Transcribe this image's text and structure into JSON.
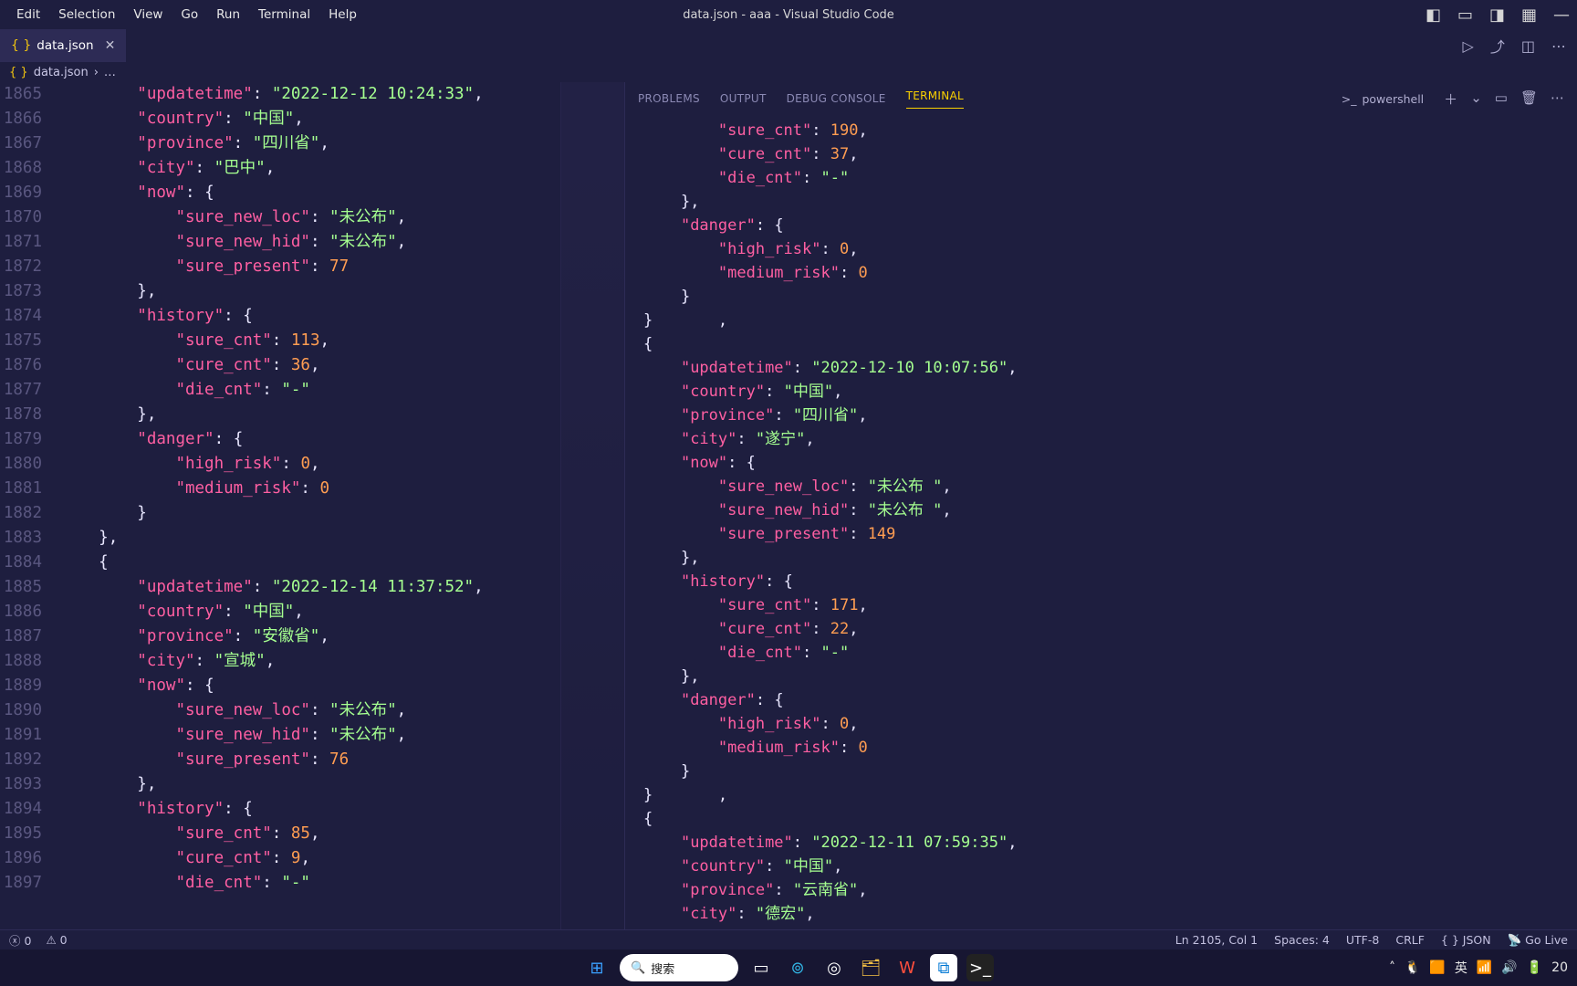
{
  "window": {
    "title": "data.json - aaa - Visual Studio Code"
  },
  "menu": {
    "items": [
      "Edit",
      "Selection",
      "View",
      "Go",
      "Run",
      "Terminal",
      "Help"
    ]
  },
  "tab": {
    "label": "data.json"
  },
  "breadcrumb": {
    "file": "data.json",
    "tail": "…"
  },
  "editor": {
    "first_line_no": 1865,
    "lines": [
      "        \"updatetime\": \"2022-12-12 10:24:33\",",
      "        \"country\": \"中国\",",
      "        \"province\": \"四川省\",",
      "        \"city\": \"巴中\",",
      "        \"now\": {",
      "            \"sure_new_loc\": \"未公布\",",
      "            \"sure_new_hid\": \"未公布\",",
      "            \"sure_present\": 77",
      "        },",
      "        \"history\": {",
      "            \"sure_cnt\": 113,",
      "            \"cure_cnt\": 36,",
      "            \"die_cnt\": \"-\"",
      "        },",
      "        \"danger\": {",
      "            \"high_risk\": 0,",
      "            \"medium_risk\": 0",
      "        }",
      "    },",
      "    {",
      "        \"updatetime\": \"2022-12-14 11:37:52\",",
      "        \"country\": \"中国\",",
      "        \"province\": \"安徽省\",",
      "        \"city\": \"宣城\",",
      "        \"now\": {",
      "            \"sure_new_loc\": \"未公布\",",
      "            \"sure_new_hid\": \"未公布\",",
      "            \"sure_present\": 76",
      "        },",
      "        \"history\": {",
      "            \"sure_cnt\": 85,",
      "            \"cure_cnt\": 9,",
      "            \"die_cnt\": \"-\""
    ]
  },
  "panel": {
    "tabs": [
      "PROBLEMS",
      "OUTPUT",
      "DEBUG CONSOLE",
      "TERMINAL"
    ],
    "active": "TERMINAL",
    "shell": "powershell",
    "lines": [
      "        \"sure_cnt\": 190,",
      "        \"cure_cnt\": 37,",
      "        \"die_cnt\": \"-\"",
      "    },",
      "    \"danger\": {",
      "        \"high_risk\": 0,",
      "        \"medium_risk\": 0",
      "    }",
      "}       ,",
      "{",
      "    \"updatetime\": \"2022-12-10 10:07:56\",",
      "    \"country\": \"中国\",",
      "    \"province\": \"四川省\",",
      "    \"city\": \"遂宁\",",
      "    \"now\": {",
      "        \"sure_new_loc\": \"未公布 \",",
      "        \"sure_new_hid\": \"未公布 \",",
      "        \"sure_present\": 149",
      "    },",
      "    \"history\": {",
      "        \"sure_cnt\": 171,",
      "        \"cure_cnt\": 22,",
      "        \"die_cnt\": \"-\"",
      "    },",
      "    \"danger\": {",
      "        \"high_risk\": 0,",
      "        \"medium_risk\": 0",
      "    }",
      "}       ,",
      "{",
      "    \"updatetime\": \"2022-12-11 07:59:35\",",
      "    \"country\": \"中国\",",
      "    \"province\": \"云南省\",",
      "    \"city\": \"德宏\","
    ]
  },
  "status": {
    "errors": "0",
    "warnings": "0",
    "ln_col": "Ln 2105, Col 1",
    "spaces": "Spaces: 4",
    "encoding": "UTF-8",
    "eol": "CRLF",
    "lang_icon": "{ }",
    "lang": "JSON",
    "golive": "Go Live"
  },
  "taskbar": {
    "search_placeholder": "搜索",
    "time_suffix": "20"
  }
}
